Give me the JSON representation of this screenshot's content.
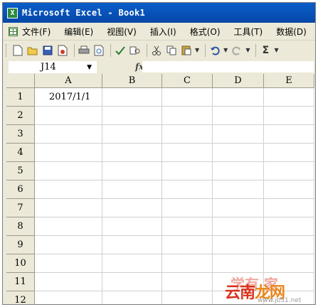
{
  "window": {
    "title": "Microsoft Excel - Book1",
    "app_icon_glyph": "X"
  },
  "menu": {
    "doc_icon": "excel-doc-icon",
    "items": [
      {
        "label": "文件(F)"
      },
      {
        "label": "编辑(E)"
      },
      {
        "label": "视图(V)"
      },
      {
        "label": "插入(I)"
      },
      {
        "label": "格式(O)"
      },
      {
        "label": "工具(T)"
      },
      {
        "label": "数据(D)"
      }
    ]
  },
  "toolbar": {
    "buttons": [
      "new-icon",
      "open-icon",
      "save-icon",
      "permission-icon",
      "print-icon",
      "print-preview-icon",
      "spelling-icon",
      "research-icon",
      "cut-icon",
      "copy-icon",
      "paste-icon",
      "undo-icon",
      "redo-icon",
      "autosum-icon"
    ],
    "autosum_glyph": "Σ"
  },
  "formula_bar": {
    "name_box": "J14",
    "fx_label": "fx",
    "formula": ""
  },
  "sheet": {
    "columns": [
      "A",
      "B",
      "C",
      "D",
      "E"
    ],
    "rows": [
      "1",
      "2",
      "3",
      "4",
      "5",
      "6",
      "7",
      "8",
      "9",
      "10",
      "11",
      "12"
    ],
    "cells": {
      "A1": "2017/1/1"
    }
  },
  "watermark": {
    "main_part1": "云南",
    "main_part2": "龙网",
    "top": "学有  家",
    "url": "www.jb51.net"
  },
  "colors": {
    "titlebar": "#0a5ec9",
    "chrome": "#ece9d8",
    "gridline": "#d0d0d0"
  }
}
